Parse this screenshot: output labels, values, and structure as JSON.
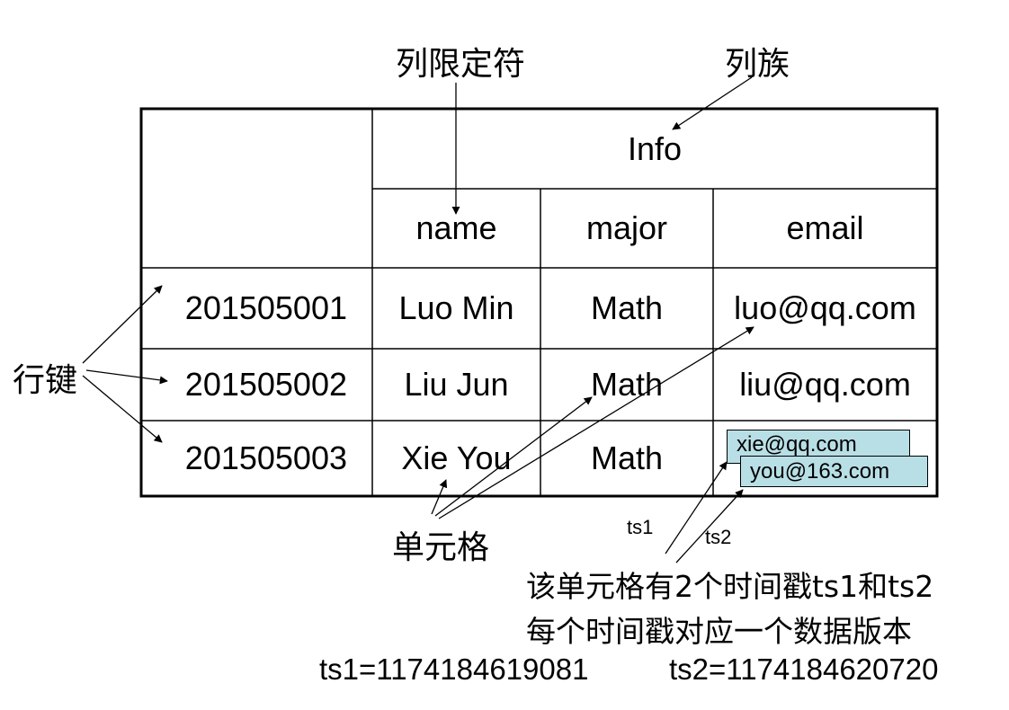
{
  "labels": {
    "column_qualifier": "列限定符",
    "column_family": "列族",
    "row_key": "行键",
    "cell": "单元格",
    "ts1_label": "ts1",
    "ts2_label": "ts2"
  },
  "table": {
    "column_family": "Info",
    "columns": [
      "name",
      "major",
      "email"
    ],
    "rows": [
      {
        "key": "201505001",
        "name": "Luo Min",
        "major": "Math",
        "email": "luo@qq.com"
      },
      {
        "key": "201505002",
        "name": "Liu Jun",
        "major": "Math",
        "email": "liu@qq.com"
      },
      {
        "key": "201505003",
        "name": "Xie You",
        "major": "Math"
      }
    ],
    "versions": {
      "old": "xie@qq.com",
      "new": "you@163.com"
    }
  },
  "notes": {
    "line1": "该单元格有2个时间戳ts1和ts2",
    "line2": "每个时间戳对应一个数据版本",
    "ts1": "ts1=1174184619081",
    "ts2": "ts2=1174184620720"
  }
}
